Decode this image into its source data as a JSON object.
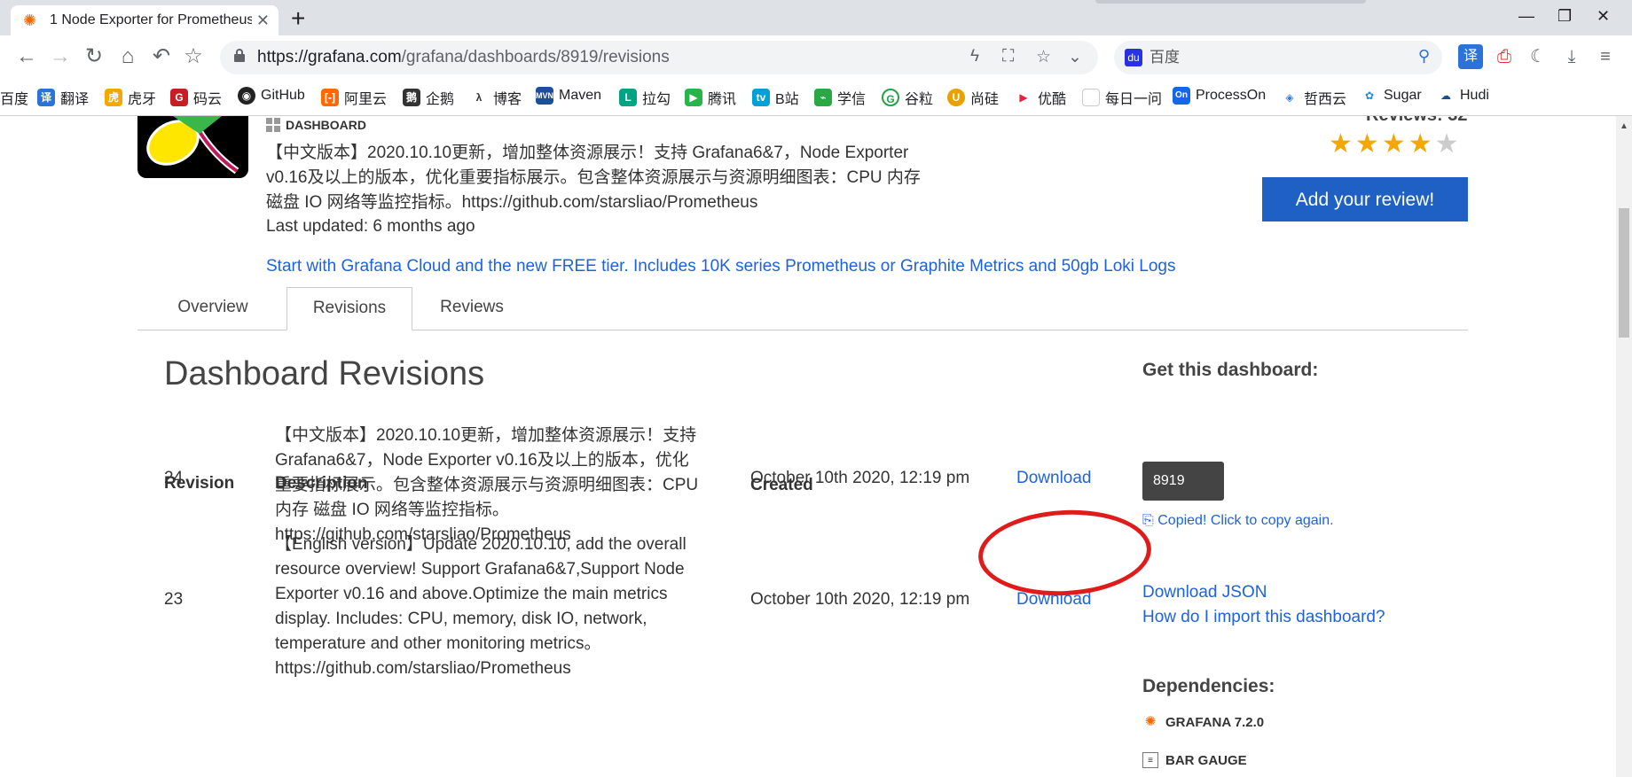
{
  "browser": {
    "tab_title": "1 Node Exporter for Prometheus",
    "url_host": "https://grafana.com",
    "url_path": "/grafana/dashboards/8919/revisions",
    "search_placeholder": "百度"
  },
  "bookmarks": [
    "百度",
    "翻译",
    "虎牙",
    "码云",
    "GitHub",
    "阿里云",
    "企鹅",
    "博客",
    "Maven",
    "拉勾",
    "腾讯",
    "B站",
    "学信",
    "谷粒",
    "尚硅",
    "优酷",
    "每日一问",
    "ProcessOn",
    "哲西云",
    "Sugar",
    "Hudi"
  ],
  "header": {
    "tag": "DASHBOARD",
    "summary": "【中文版本】2020.10.10更新，增加整体资源展示！支持 Grafana6&7，Node Exporter v0.16及以上的版本，优化重要指标展示。包含整体资源展示与资源明细图表：CPU 内存 磁盘 IO 网络等监控指标。https://github.com/starsliao/Prometheus",
    "last_updated": "Last updated: 6 months ago",
    "cloud_link": "Start with Grafana Cloud and the new FREE tier. Includes 10K series Prometheus or Graphite Metrics and 50gb Loki Logs",
    "reviews_count": "Reviews: 32",
    "rating": 4,
    "review_button": "Add your review!"
  },
  "tabs": [
    "Overview",
    "Revisions",
    "Reviews"
  ],
  "active_tab": "Revisions",
  "main": {
    "heading": "Dashboard Revisions",
    "columns": {
      "revision": "Revision",
      "description": "Description",
      "created": "Created"
    },
    "rows": [
      {
        "revision": "24",
        "description": "【中文版本】2020.10.10更新，增加整体资源展示！支持Grafana6&7，Node Exporter v0.16及以上的版本，优化重要指标展示。包含整体资源展示与资源明细图表：CPU 内存 磁盘 IO 网络等监控指标。https://github.com/starsliao/Prometheus",
        "created": "October 10th 2020, 12:19 pm",
        "action": "Download"
      },
      {
        "revision": "23",
        "description": "【English version】Update 2020.10.10, add the overall resource overview! Support Grafana6&7,Support Node Exporter v0.16 and above.Optimize the main metrics display. Includes: CPU, memory, disk IO, network, temperature and other monitoring metrics。https://github.com/starsliao/Prometheus",
        "created": "October 10th 2020, 12:19 pm",
        "action": "Download"
      }
    ]
  },
  "sidebar": {
    "get_heading": "Get this dashboard:",
    "dashboard_id": "8919",
    "copied_text": "Copied! Click to copy again.",
    "download_json": "Download JSON",
    "import_link": "How do I import this dashboard?",
    "deps_heading": "Dependencies:",
    "deps": [
      "GRAFANA 7.2.0",
      "BAR GAUGE"
    ]
  },
  "colors": {
    "link": "#1f62e0",
    "button": "#1f60c4",
    "star": "#f5a700",
    "annotation": "#e01b1b"
  }
}
